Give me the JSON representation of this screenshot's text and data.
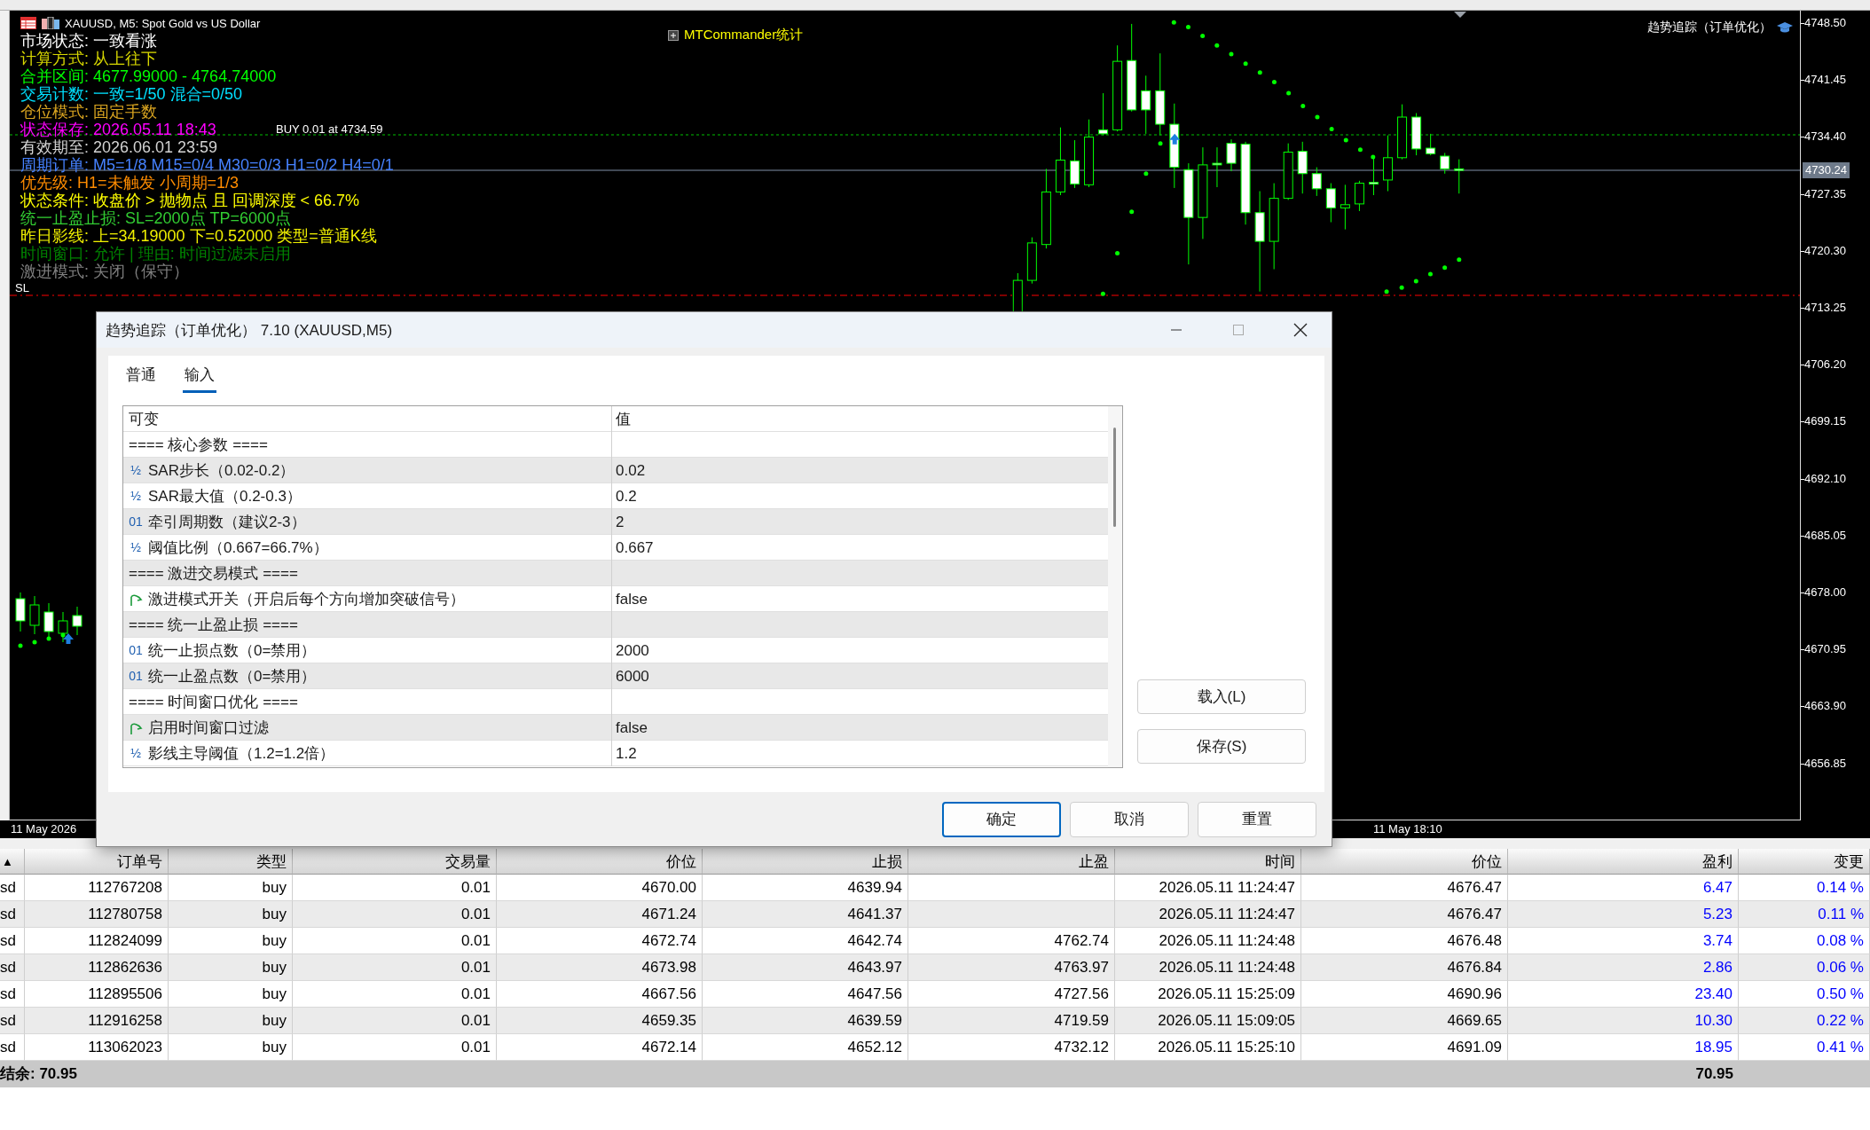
{
  "chart": {
    "symbol_title": "XAUUSD, M5:  Spot Gold vs US Dollar",
    "info_lines": [
      {
        "text": "市场状态: 一致看涨",
        "color": "#ffffff"
      },
      {
        "text": "计算方式: 从上往下",
        "color": "#d8d800"
      },
      {
        "text": "合并区间: 4677.99000 - 4764.74000",
        "color": "#00ff00"
      },
      {
        "text": "交易计数: 一致=1/50 混合=0/50",
        "color": "#00e0ff"
      },
      {
        "text": "仓位模式: 固定手数",
        "color": "#daa520"
      },
      {
        "text": "状态保存: 2026.05.11 18:43",
        "color": "#ff00ff"
      },
      {
        "text": "有效期至: 2026.06.01 23:59",
        "color": "#d3d3d3"
      },
      {
        "text": "周期订单: M5=1/8 M15=0/4 M30=0/3 H1=0/2 H4=0/1",
        "color": "#4682ff"
      },
      {
        "text": "优先级: H1=未触发 小周期=1/3",
        "color": "#ff8c00"
      },
      {
        "text": "状态条件: 收盘价 > 抛物点 且 回调深度 < 66.7%",
        "color": "#ffff00"
      },
      {
        "text": "统一止盈止损: SL=2000点 TP=6000点",
        "color": "#32cd32"
      },
      {
        "text": "昨日影线: 上=34.19000 下=0.52000 类型=普通K线",
        "color": "#f0f000"
      },
      {
        "text": "时间窗口: 允许 | 理由: 时间过滤未启用",
        "color": "#008000"
      },
      {
        "text": "激进模式: 关闭（保守）",
        "color": "#808080"
      }
    ],
    "trade_label": "BUY 0.01 at 4734.59",
    "sl_label": "SL",
    "panel_button": "MTCommander统计",
    "indicator_name": "趋势追踪（订单优化）",
    "price_axis": {
      "labels": [
        "4748.50",
        "4741.45",
        "4734.40",
        "4727.35",
        "4720.30",
        "4713.25",
        "4706.20",
        "4699.15",
        "4692.10",
        "4685.05",
        "4678.00",
        "4670.95",
        "4663.90",
        "4656.85"
      ],
      "current_price": "4730.24"
    },
    "time_axis": [
      "11 May 2026",
      "11 May 18:10"
    ]
  },
  "dialog": {
    "title": "趋势追踪（订单优化） 7.10 (XAUUSD,M5)",
    "tabs": [
      {
        "label": "普通",
        "selected": false
      },
      {
        "label": "输入",
        "selected": true
      }
    ],
    "params": {
      "columns": [
        "可变",
        "值"
      ],
      "rows": [
        {
          "kind": "group",
          "name": "==== 核心参数 ===="
        },
        {
          "kind": "double",
          "icon": "½",
          "name": "SAR步长（0.02-0.2）",
          "value": "0.02"
        },
        {
          "kind": "double",
          "icon": "½",
          "name": "SAR最大值（0.2-0.3）",
          "value": "0.2"
        },
        {
          "kind": "int",
          "icon": "01",
          "name": "牵引周期数（建议2-3）",
          "value": "2"
        },
        {
          "kind": "double",
          "icon": "½",
          "name": "阈值比例（0.667=66.7%）",
          "value": "0.667"
        },
        {
          "kind": "group",
          "name": "==== 激进交易模式 ===="
        },
        {
          "kind": "bool",
          "name": "激进模式开关（开启后每个方向增加突破信号）",
          "value": "false"
        },
        {
          "kind": "group",
          "name": "==== 统一止盈止损 ===="
        },
        {
          "kind": "int",
          "icon": "01",
          "name": "统一止损点数（0=禁用）",
          "value": "2000"
        },
        {
          "kind": "int",
          "icon": "01",
          "name": "统一止盈点数（0=禁用）",
          "value": "6000"
        },
        {
          "kind": "group",
          "name": "==== 时间窗口优化 ===="
        },
        {
          "kind": "bool",
          "name": "启用时间窗口过滤",
          "value": "false"
        },
        {
          "kind": "double",
          "icon": "½",
          "name": "影线主导阈值（1.2=1.2倍）",
          "value": "1.2"
        }
      ]
    },
    "side_buttons": [
      "载入(L)",
      "保存(S)"
    ],
    "buttons": [
      {
        "label": "确定",
        "primary": true
      },
      {
        "label": "取消",
        "primary": false
      },
      {
        "label": "重置",
        "primary": false
      }
    ]
  },
  "orders": {
    "sort_indicator": "▲",
    "columns": [
      "订单号",
      "类型",
      "交易量",
      "价位",
      "止损",
      "止盈",
      "时间",
      "价位",
      "盈利",
      "变更"
    ],
    "rows": [
      {
        "symbol": "sd",
        "ticket": "112767208",
        "type": "buy",
        "volume": "0.01",
        "price": "4670.00",
        "sl": "4639.94",
        "time": "2026.05.11 11:24:47",
        "current_price": "4676.47",
        "profit": "6.47",
        "change": "0.14 %"
      },
      {
        "symbol": "sd",
        "ticket": "112780758",
        "type": "buy",
        "volume": "0.01",
        "price": "4671.24",
        "sl": "4641.37",
        "time": "2026.05.11 11:24:47",
        "current_price": "4676.47",
        "profit": "5.23",
        "change": "0.11 %"
      },
      {
        "symbol": "sd",
        "ticket": "112824099",
        "type": "buy",
        "volume": "0.01",
        "price": "4672.74",
        "sl": "4642.74",
        "tp": "4762.74",
        "time": "2026.05.11 11:24:48",
        "current_price": "4676.48",
        "profit": "3.74",
        "change": "0.08 %"
      },
      {
        "symbol": "sd",
        "ticket": "112862636",
        "type": "buy",
        "volume": "0.01",
        "price": "4673.98",
        "sl": "4643.97",
        "tp": "4763.97",
        "time": "2026.05.11 11:24:48",
        "current_price": "4676.84",
        "profit": "2.86",
        "change": "0.06 %"
      },
      {
        "symbol": "sd",
        "ticket": "112895506",
        "type": "buy",
        "volume": "0.01",
        "price": "4667.56",
        "sl": "4647.56",
        "tp": "4727.56",
        "time": "2026.05.11 15:25:09",
        "current_price": "4690.96",
        "profit": "23.40",
        "change": "0.50 %"
      },
      {
        "symbol": "sd",
        "ticket": "112916258",
        "type": "buy",
        "volume": "0.01",
        "price": "4659.35",
        "sl": "4639.59",
        "tp": "4719.59",
        "time": "2026.05.11 15:09:05",
        "current_price": "4669.65",
        "profit": "10.30",
        "change": "0.22 %"
      },
      {
        "symbol": "sd",
        "ticket": "113062023",
        "type": "buy",
        "volume": "0.01",
        "price": "4672.14",
        "sl": "4652.12",
        "tp": "4732.12",
        "time": "2026.05.11 15:25:10",
        "current_price": "4691.09",
        "profit": "18.95",
        "change": "0.41 %"
      }
    ],
    "footer": {
      "balance": "结余: 70.95",
      "total_profit": "70.95"
    }
  }
}
